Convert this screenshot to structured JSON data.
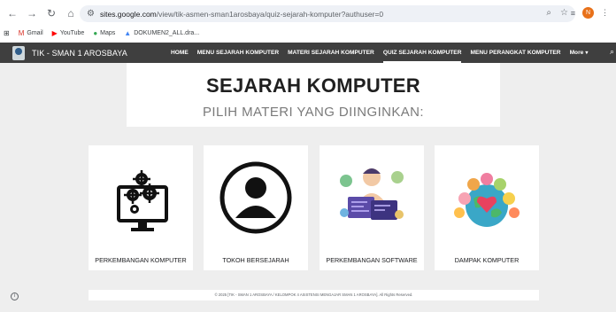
{
  "browser": {
    "url_host": "sites.google.com",
    "url_path": "/view/tik-asmen-sman1arosbaya/quiz-sejarah-komputer?authuser=0",
    "profile_initial": "N",
    "bookmarks": [
      {
        "label": "Gmail",
        "icon": "gmail-icon"
      },
      {
        "label": "YouTube",
        "icon": "youtube-icon"
      },
      {
        "label": "Maps",
        "icon": "maps-icon"
      },
      {
        "label": "DOKUMEN2_ALL.dra...",
        "icon": "drive-icon"
      }
    ]
  },
  "site": {
    "title": "TIK - SMAN 1 AROSBAYA",
    "nav": [
      {
        "label": "HOME",
        "active": false
      },
      {
        "label": "MENU SEJARAH KOMPUTER",
        "active": false
      },
      {
        "label": "MATERI SEJARAH KOMPUTER",
        "active": false
      },
      {
        "label": "QUIZ SEJARAH KOMPUTER",
        "active": true
      },
      {
        "label": "MENU PERANGKAT KOMPUTER",
        "active": false
      }
    ],
    "more_label": "More"
  },
  "main": {
    "title": "SEJARAH KOMPUTER",
    "subtitle": "PILIH MATERI YANG DIINGINKAN:",
    "cards": [
      {
        "label": "PERKEMBANGAN KOMPUTER",
        "icon": "computer-gears-icon"
      },
      {
        "label": "TOKOH BERSEJARAH",
        "icon": "person-icon"
      },
      {
        "label": "PERKEMBANGAN SOFTWARE",
        "icon": "software-developer-icon"
      },
      {
        "label": "DAMPAK KOMPUTER",
        "icon": "globe-people-heart-icon"
      }
    ],
    "footer": "© 2025 [TIK - SMAN 1 AROSBAYA / KELOMPOK 4 ASISTENSI MENGAJAR SMAN 1 AROSBAYA]. All Rights Reserved."
  },
  "colors": {
    "header_bg": "#3f3f3f",
    "page_bg": "#eeeeee",
    "accent_orange": "#e8711a"
  }
}
